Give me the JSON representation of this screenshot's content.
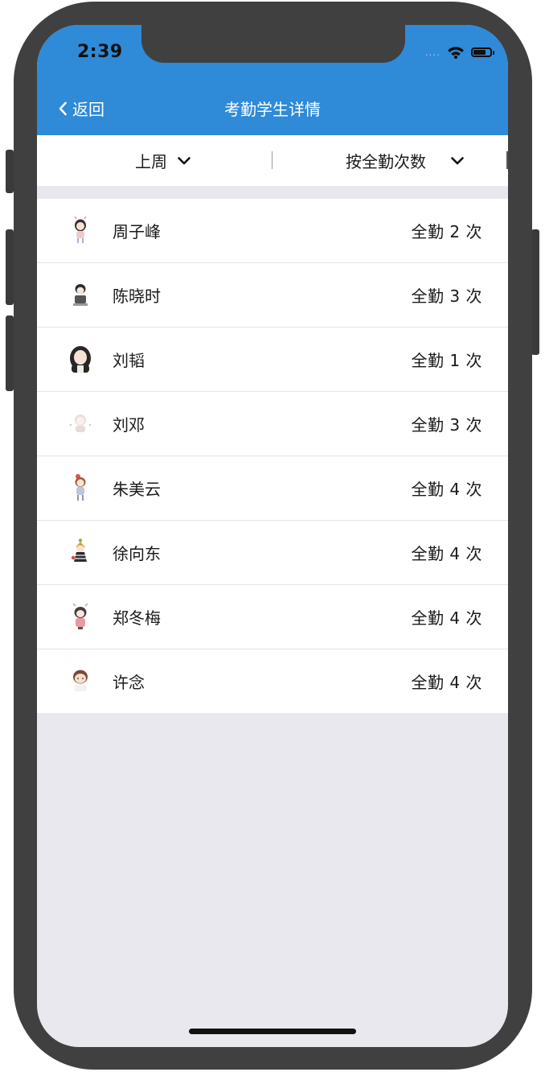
{
  "status": {
    "time": "2:39",
    "signal_dots": "....",
    "wifi_icon": "wifi-icon",
    "battery_icon": "battery-icon"
  },
  "nav": {
    "back_label": "返回",
    "title": "考勤学生详情",
    "bar_color": "#2f8ad7"
  },
  "filters": {
    "period": "上周",
    "sort": "按全勤次数"
  },
  "students": [
    {
      "name": "周子峰",
      "count": "全勤 2 次"
    },
    {
      "name": "陈晓时",
      "count": "全勤 3 次"
    },
    {
      "name": "刘韬",
      "count": "全勤 1 次"
    },
    {
      "name": "刘邓",
      "count": "全勤 3 次"
    },
    {
      "name": "朱美云",
      "count": "全勤 4 次"
    },
    {
      "name": "徐向东",
      "count": "全勤 4 次"
    },
    {
      "name": "郑冬梅",
      "count": "全勤 4 次"
    },
    {
      "name": "许念",
      "count": "全勤 4 次"
    }
  ]
}
